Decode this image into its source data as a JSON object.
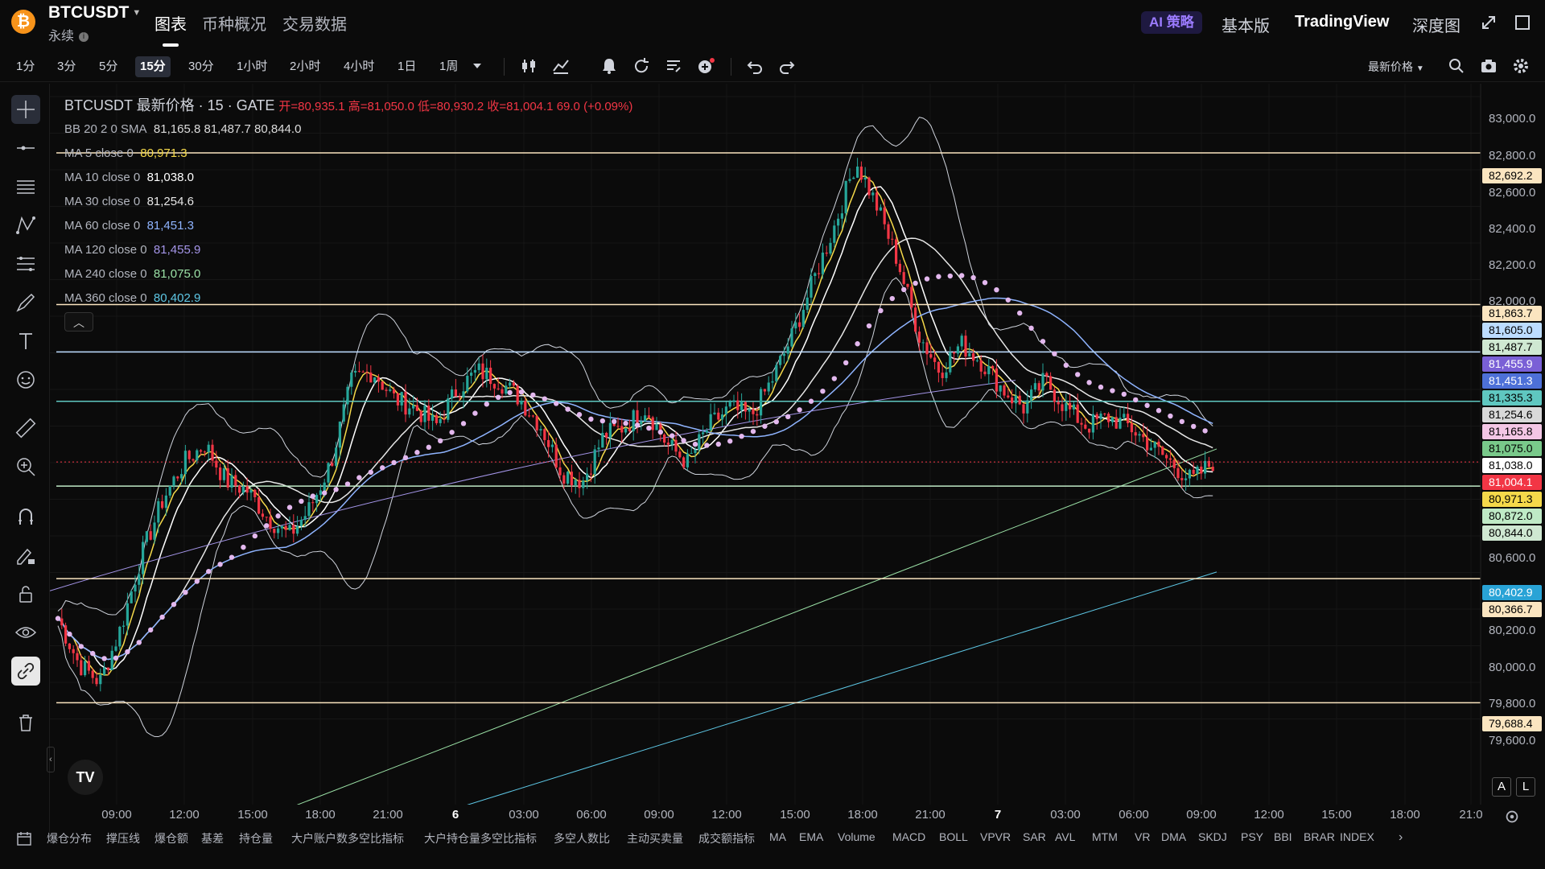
{
  "header": {
    "symbol": "BTCUSDT",
    "logo_letter": "₿",
    "contract_type": "永续",
    "main_tabs": [
      "图表",
      "币种概况",
      "交易数据"
    ],
    "ai_label": "AI 策略",
    "right_tabs": [
      "基本版",
      "TradingView",
      "深度图"
    ],
    "icons": [
      "expand-icon",
      "window-icon"
    ]
  },
  "toolbar": {
    "intervals": [
      "1分",
      "3分",
      "5分",
      "15分",
      "30分",
      "1小时",
      "2小时",
      "4小时",
      "1日",
      "1周"
    ],
    "active_interval": "15分",
    "price_type": "最新价格",
    "icons": [
      "candles-icon",
      "indicator-icon",
      "alert-icon",
      "replay-icon",
      "template-icon",
      "add-icon",
      "undo-icon",
      "redo-icon",
      "search-icon",
      "camera-icon",
      "gear-icon"
    ]
  },
  "legend": {
    "title": "BTCUSDT 最新价格 · 15 · GATE",
    "open": "开=80,935.1",
    "high": "高=81,050.0",
    "low": "低=80,930.2",
    "close": "收=81,004.1",
    "change": "69.0 (+0.09%)",
    "bb_label": "BB 20 2 0 SMA",
    "bb_values": "81,165.8  81,487.7  80,844.0",
    "ma": [
      {
        "label": "MA 5 close 0",
        "value": "80,971.3",
        "color": "#f5d94a"
      },
      {
        "label": "MA 10 close 0",
        "value": "81,038.0",
        "color": "#ffffff"
      },
      {
        "label": "MA 30 close 0",
        "value": "81,254.6",
        "color": "#e6e6e6"
      },
      {
        "label": "MA 60 close 0",
        "value": "81,451.3",
        "color": "#8fb4ff"
      },
      {
        "label": "MA 120 close 0",
        "value": "81,455.9",
        "color": "#a495e8"
      },
      {
        "label": "MA 240 close 0",
        "value": "81,075.0",
        "color": "#9be1a6"
      },
      {
        "label": "MA 360 close 0",
        "value": "80,402.9",
        "color": "#5ec8e6"
      }
    ]
  },
  "price_axis": {
    "ticks": [
      "83,000.0",
      "82,800.0",
      "82,600.0",
      "82,400.0",
      "82,200.0",
      "82,000.0",
      "80,600.0",
      "80,200.0",
      "80,000.0",
      "79,800.0",
      "79,600.0"
    ],
    "labels": [
      {
        "text": "82,692.2",
        "bg": "#fbe5c0",
        "fg": "#000000"
      },
      {
        "text": "81,863.7",
        "bg": "#fbe5c0",
        "fg": "#000000"
      },
      {
        "text": "81,605.0",
        "bg": "#bcdcff",
        "fg": "#000000"
      },
      {
        "text": "81,487.7",
        "bg": "#cfe8d2",
        "fg": "#000000"
      },
      {
        "text": "81,455.9",
        "bg": "#7a60d6",
        "fg": "#ffffff"
      },
      {
        "text": "81,451.3",
        "bg": "#4d70d8",
        "fg": "#ffffff"
      },
      {
        "text": "81,335.3",
        "bg": "#5fc7c0",
        "fg": "#000000"
      },
      {
        "text": "81,254.6",
        "bg": "#d9d9d9",
        "fg": "#000000"
      },
      {
        "text": "81,165.8",
        "bg": "#f3c6e5",
        "fg": "#000000"
      },
      {
        "text": "81,075.0",
        "bg": "#79c98a",
        "fg": "#000000"
      },
      {
        "text": "81,038.0",
        "bg": "#ffffff",
        "fg": "#000000"
      },
      {
        "text": "81,004.1",
        "bg": "#f23645",
        "fg": "#ffffff"
      },
      {
        "text": "80,971.3",
        "bg": "#f5d94a",
        "fg": "#000000"
      },
      {
        "text": "80,872.0",
        "bg": "#bfeac6",
        "fg": "#000000"
      },
      {
        "text": "80,844.0",
        "bg": "#cfe8d2",
        "fg": "#000000"
      },
      {
        "text": "80,402.9",
        "bg": "#29a3d6",
        "fg": "#ffffff"
      },
      {
        "text": "80,366.7",
        "bg": "#fbe5c0",
        "fg": "#000000"
      },
      {
        "text": "79,688.4",
        "bg": "#fbe5c0",
        "fg": "#000000"
      }
    ]
  },
  "time_axis": [
    "09:00",
    "12:00",
    "15:00",
    "18:00",
    "21:00",
    "6",
    "03:00",
    "06:00",
    "09:00",
    "12:00",
    "15:00",
    "18:00",
    "21:00",
    "7",
    "03:00",
    "06:00",
    "09:00",
    "12:00",
    "15:00",
    "18:00",
    "21:0"
  ],
  "bottom_indicators": [
    "爆仓分布",
    "撑压线",
    "爆仓额",
    "基差",
    "持仓量",
    "大户账户数多空比指标",
    "大户持仓量多空比指标",
    "多空人数比",
    "主动买卖量",
    "成交额指标",
    "MA",
    "EMA",
    "Volume",
    "MACD",
    "BOLL",
    "VPVR",
    "SAR",
    "AVL",
    "MTM",
    "VR",
    "DMA",
    "SKDJ",
    "PSY",
    "BBI",
    "BRAR",
    "INDEX"
  ],
  "tv_logo": "TV",
  "scale_buttons": [
    "A",
    "L"
  ],
  "chart_data": {
    "type": "candlestick",
    "symbol": "BTCUSDT",
    "ylim": [
      79500,
      83100
    ],
    "horizontal_levels": [
      82692.2,
      81863.7,
      81605.0,
      81335.3,
      80872.0,
      80366.7,
      79688.4
    ],
    "last_price": 81004.1,
    "series_closes_sample": [
      80150,
      79900,
      79800,
      80100,
      80500,
      80800,
      81000,
      81100,
      80900,
      80850,
      80700,
      80600,
      80750,
      81000,
      81450,
      81500,
      81350,
      81300,
      81200,
      81400,
      81500,
      81450,
      81350,
      81200,
      80950,
      80900,
      81150,
      81200,
      81300,
      81100,
      81000,
      81200,
      81300,
      81250,
      81450,
      81700,
      82000,
      82300,
      82650,
      82400,
      82100,
      81700,
      81500,
      81650,
      81550,
      81400,
      81300,
      81450,
      81300,
      81200,
      81250,
      81200,
      81100,
      81000,
      80900,
      81004
    ]
  }
}
